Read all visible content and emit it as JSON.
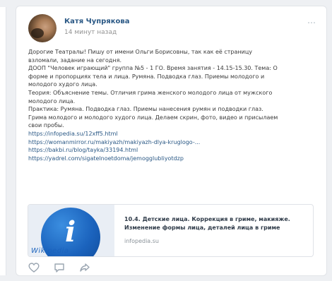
{
  "post": {
    "author": "Катя Чупрякова",
    "time": "14 минут назад",
    "menu_icon": "more-dots-icon",
    "lines": [
      "Дорогие Театралы! Пишу от имени Ольги Борисовны, так как её страницу",
      "взломали, задание на сегодня.",
      "ДООП \"Человек играющий\" группа №5 - 1 ГО. Время занятия - 14.15-15.30. Тема: О",
      "форме и пропорциях тела и лица. Румяна. Подводка глаз. Приемы молодого и",
      "молодого худого лица.",
      "Теория: Объяснение темы. Отличия грима женского молодого лица от мужского",
      "молодого лица.",
      "Практика: Румяна. Подводка глаз. Приемы нанесения румян и подводки глаз.",
      "Грима молодого и молодого худого лица. Делаем скрин, фото, видео и присылаем",
      "свои пробы."
    ],
    "links": [
      "https://infopedia.su/12xff5.html",
      "https://womanmirror.ru/makiyazh/makiyazh-dlya-kruglogo-...",
      "https://bakbi.ru/blog/tayka/33194.html",
      "https://yadrel.com/sigatelnoetdoma/jemogglubliyotdzp"
    ]
  },
  "attachment": {
    "thumb_wordmark": "Wikipedia",
    "title": "10.4. Детские лица. Коррекция в гриме, макияже. Изменение формы лица, деталей лица в гриме",
    "domain": "infopedia.su"
  },
  "actions": {
    "icons": [
      "heart-icon",
      "comment-icon",
      "share-icon"
    ]
  },
  "colors": {
    "link": "#2a5885",
    "text": "#3a3a3a",
    "muted": "#939393",
    "page_bg": "#eef0f3"
  }
}
